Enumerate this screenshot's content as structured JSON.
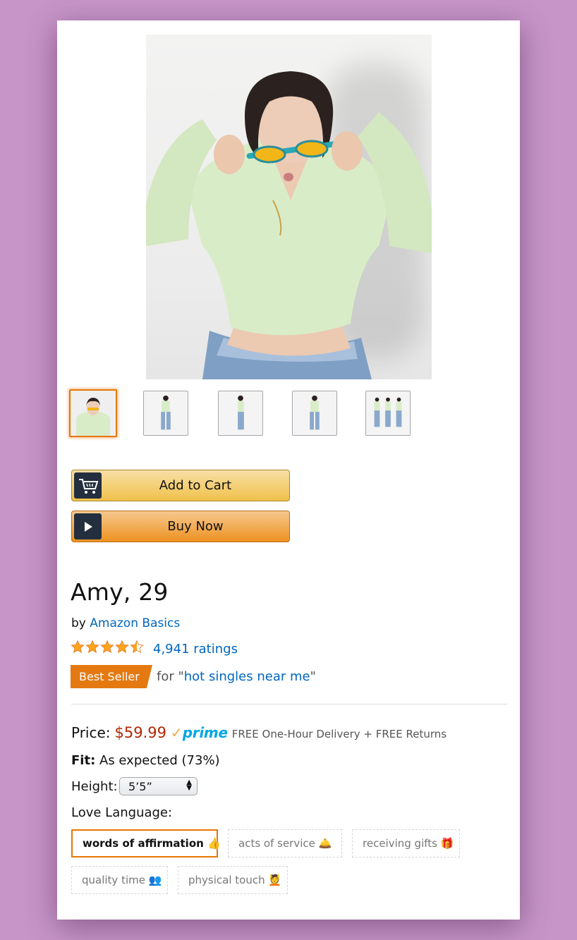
{
  "product": {
    "title": "Amy, 29",
    "by_prefix": "by",
    "brand": "Amazon Basics",
    "ratings_text": "4,941 ratings",
    "rating_stars": 4.5,
    "badge": "Best Seller",
    "badge_for_prefix": "for \"",
    "badge_category": "hot singles near me",
    "badge_for_suffix": "\""
  },
  "thumbnails": {
    "count": 5,
    "selected": 0
  },
  "buttons": {
    "add_to_cart": "Add to Cart",
    "buy_now": "Buy Now"
  },
  "details": {
    "price_label": "Price:",
    "price": "$59.99",
    "prime_check": "✓",
    "prime_word": "prime",
    "delivery": "FREE One-Hour Delivery + FREE Returns",
    "fit_label": "Fit:",
    "fit_value": "As expected (73%)",
    "height_label": "Height:",
    "height_value": "5’5”",
    "love_language_label": "Love Language:"
  },
  "love_languages": [
    {
      "label": "words of affirmation 👍",
      "selected": true
    },
    {
      "label": "acts of service 🛎️",
      "selected": false
    },
    {
      "label": "receiving gifts 🎁",
      "selected": false
    },
    {
      "label": "quality time 👥",
      "selected": false
    },
    {
      "label": "physical touch 💆",
      "selected": false
    }
  ],
  "colors": {
    "price": "#b12704",
    "link": "#0066c0",
    "badge": "#e47911",
    "selected": "#e77600",
    "prime": "#00a8e1",
    "background": "#c795c7"
  }
}
